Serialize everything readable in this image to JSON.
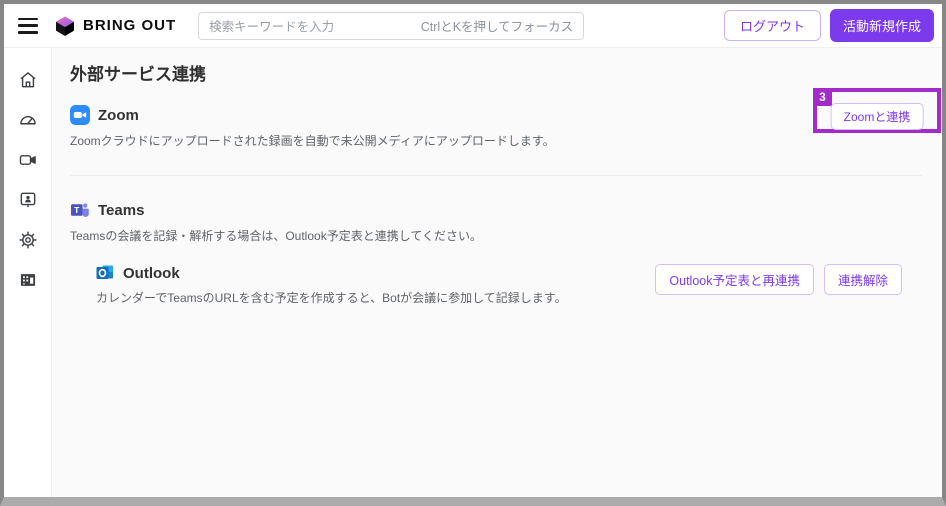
{
  "header": {
    "brand": "BRING OUT",
    "search_placeholder": "検索キーワードを入力",
    "search_hint": "CtrlとKを押してフォーカス",
    "logout_button": "ログアウト",
    "new_activity_button": "活動新規作成"
  },
  "sidebar": {
    "items": [
      {
        "icon": "home-icon"
      },
      {
        "icon": "dashboard-icon"
      },
      {
        "icon": "video-camera-icon"
      },
      {
        "icon": "contact-card-icon"
      },
      {
        "icon": "gear-icon"
      },
      {
        "icon": "building-icon"
      }
    ]
  },
  "page": {
    "title": "外部サービス連携"
  },
  "zoom_section": {
    "title": "Zoom",
    "description": "Zoomクラウドにアップロードされた録画を自動で未公開メディアにアップロードします。",
    "connect_button": "Zoomと連携"
  },
  "teams_section": {
    "title": "Teams",
    "description": "Teamsの会議を記録・解析する場合は、Outlook予定表と連携してください。"
  },
  "outlook_section": {
    "title": "Outlook",
    "description": "カレンダーでTeamsのURLを含む予定を作成すると、Botが会議に参加して記録します。",
    "reconnect_button": "Outlook予定表と再連携",
    "disconnect_button": "連携解除"
  },
  "annotation": {
    "step": "3"
  },
  "colors": {
    "accent_purple": "#7C3AED",
    "annotation_purple": "#A32BC8",
    "zoom_blue": "#2D8CFF",
    "teams_purple": "#4B53BC",
    "outlook_blue": "#0F6CBD",
    "frame_gray": "#878787"
  }
}
